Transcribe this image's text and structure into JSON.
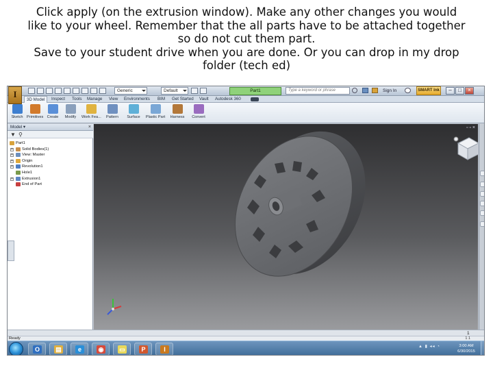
{
  "caption": {
    "lines": [
      "Click apply (on the extrusion window).  Make any other changes you would",
      "like to your wheel.  Remember that the all parts have to be attached together",
      "so do not cut them part.",
      "Save to your student drive when you are done.  Or you can drop in my drop",
      "folder (tech ed)"
    ]
  },
  "titlebar": {
    "app_letter": "I",
    "style_combo": "Generic",
    "appearance_combo": "Default",
    "document_tab": "Part1",
    "search_placeholder": "Type a keyword or phrase",
    "sign_in": "Sign In",
    "smart_button": "SMART Ink",
    "minimize": "–",
    "maximize": "□",
    "close": "×"
  },
  "ribbon": {
    "tabs": [
      "3D Model",
      "Inspect",
      "Tools",
      "Manage",
      "View",
      "Environments",
      "BIM",
      "Get Started",
      "Vault",
      "Autodesk 360"
    ],
    "active_tab_index": 0,
    "buttons": [
      {
        "label": "Sketch",
        "icon": "sketch-icon",
        "color": "#3e7fd0"
      },
      {
        "label": "Primitives",
        "icon": "primitives-icon",
        "color": "#d27a2c"
      },
      {
        "label": "Create",
        "icon": "create-icon",
        "color": "#5a8fd8"
      },
      {
        "label": "Modify",
        "icon": "modify-icon",
        "color": "#8aa0bc"
      },
      {
        "label": "Work Fea...",
        "icon": "work-features-icon",
        "color": "#e0b340"
      },
      {
        "label": "Pattern",
        "icon": "pattern-icon",
        "color": "#6f90c0"
      },
      {
        "label": "Surface",
        "icon": "surface-icon",
        "color": "#5fb0d8"
      },
      {
        "label": "Plastic Part",
        "icon": "plastic-part-icon",
        "color": "#7aa7d6"
      },
      {
        "label": "Harness",
        "icon": "harness-icon",
        "color": "#b3783a"
      },
      {
        "label": "Convert",
        "icon": "convert-icon",
        "color": "#9a6cbf"
      }
    ]
  },
  "browser": {
    "title": "Model ▾",
    "close": "×",
    "tree": [
      {
        "label": "Part1",
        "indent": 0,
        "expander": "",
        "icon_color": "#d8a23a"
      },
      {
        "label": "Solid Bodies(1)",
        "indent": 1,
        "expander": "+",
        "icon_color": "#c98f4a"
      },
      {
        "label": "View: Master",
        "indent": 1,
        "expander": "+",
        "icon_color": "#6c8fbd"
      },
      {
        "label": "Origin",
        "indent": 1,
        "expander": "+",
        "icon_color": "#e0a83a"
      },
      {
        "label": "Revolution1",
        "indent": 1,
        "expander": "+",
        "icon_color": "#4f7ec2"
      },
      {
        "label": "Hole1",
        "indent": 1,
        "expander": "",
        "icon_color": "#7a9a4c"
      },
      {
        "label": "Extrusion1",
        "indent": 1,
        "expander": "+",
        "icon_color": "#5d86c4"
      },
      {
        "label": "End of Part",
        "indent": 1,
        "expander": "",
        "icon_color": "#c84040"
      }
    ]
  },
  "bottom": {
    "page_number": "1",
    "status": "Ready",
    "status_right": "1   1"
  },
  "taskbar": {
    "items": [
      {
        "icon": "outlook-icon",
        "glyph": "O",
        "color": "#2f6fc0"
      },
      {
        "icon": "file-explorer-icon",
        "glyph": "▤",
        "color": "#e0b040"
      },
      {
        "icon": "internet-explorer-icon",
        "glyph": "e",
        "color": "#2a8fd8"
      },
      {
        "icon": "chrome-icon",
        "glyph": "◉",
        "color": "#d84a3a"
      },
      {
        "icon": "sticky-notes-icon",
        "glyph": "▭",
        "color": "#e8d85a"
      },
      {
        "icon": "powerpoint-icon",
        "glyph": "P",
        "color": "#d2582e"
      },
      {
        "icon": "inventor-icon",
        "glyph": "I",
        "color": "#c97a20"
      }
    ],
    "time": "3:00 AM",
    "date": "6/30/2015"
  }
}
